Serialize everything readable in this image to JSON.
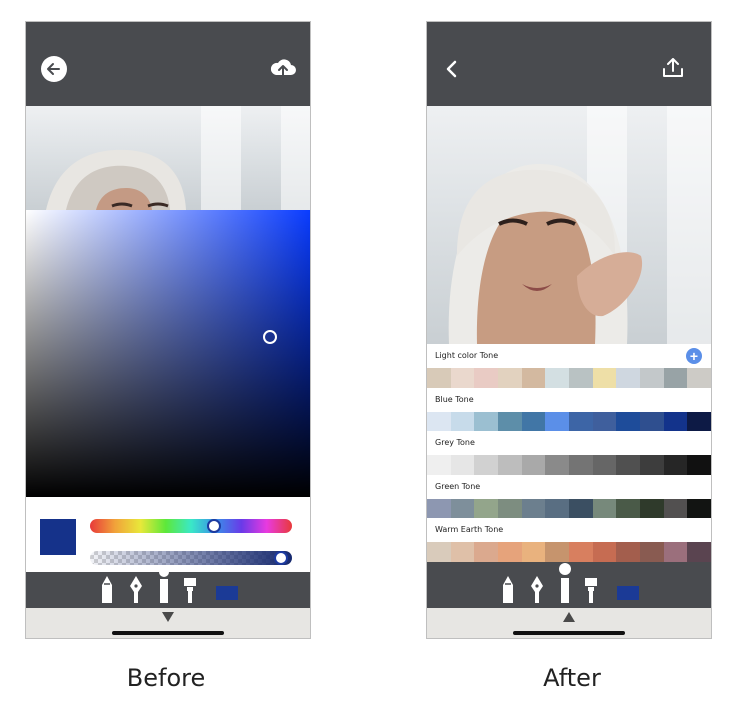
{
  "captions": {
    "before": "Before",
    "after": "After"
  },
  "before": {
    "header": {
      "back_icon": "arrow-left-icon",
      "upload_icon": "cloud-upload-icon"
    },
    "selected_color": "#15328a",
    "hue_position": 0.62,
    "alpha_position": 0.98,
    "tools": [
      "pencil-icon",
      "fountain-pen-icon",
      "brush-icon",
      "marker-icon"
    ],
    "tool_swatch_color": "#1b3a96"
  },
  "after": {
    "header": {
      "back_icon": "chevron-left-icon",
      "share_icon": "share-upload-icon"
    },
    "add_icon": "plus-circle-icon",
    "tones": [
      {
        "label": "Light color Tone",
        "colors": [
          "#d8cab8",
          "#ead8cd",
          "#e9cbc4",
          "#e2d2bf",
          "#d3b9a0",
          "#d3dfe2",
          "#b9c2c3",
          "#eedfa7",
          "#cfd7e0",
          "#c3c8ca",
          "#98a3a6",
          "#cdcbc6"
        ]
      },
      {
        "label": "Blue Tone",
        "colors": [
          "#dce6f2",
          "#c7dbea",
          "#9bbfd1",
          "#5d8ea9",
          "#4176a6",
          "#5b8fe8",
          "#3d65a6",
          "#3f5f9d",
          "#1e4c9a",
          "#2f4f8f",
          "#13338b",
          "#0d1a45"
        ]
      },
      {
        "label": "Grey Tone",
        "colors": [
          "#efefef",
          "#e6e6e6",
          "#d1d1d1",
          "#bdbdbd",
          "#a9a9a9",
          "#8a8a8a",
          "#747474",
          "#666666",
          "#505050",
          "#3d3d3d",
          "#262626",
          "#111111"
        ]
      },
      {
        "label": "Green Tone",
        "colors": [
          "#8d97b1",
          "#7e8f9b",
          "#93a58b",
          "#7d8d80",
          "#6c7f8e",
          "#596e82",
          "#3b4f62",
          "#77897b",
          "#4a5a48",
          "#2f3a2b",
          "#525050",
          "#121412"
        ]
      },
      {
        "label": "Warm Earth Tone",
        "colors": [
          "#d9cbbb",
          "#dfc0a8",
          "#dba98e",
          "#e6a37b",
          "#e9b27e",
          "#c6946d",
          "#d87f5f",
          "#c66c52",
          "#a35e4d",
          "#895b51",
          "#9b6f7c",
          "#5a4450"
        ]
      }
    ],
    "tools": [
      "pencil-icon",
      "fountain-pen-icon",
      "brush-icon",
      "marker-icon"
    ],
    "tool_swatch_color": "#1b3a96"
  }
}
